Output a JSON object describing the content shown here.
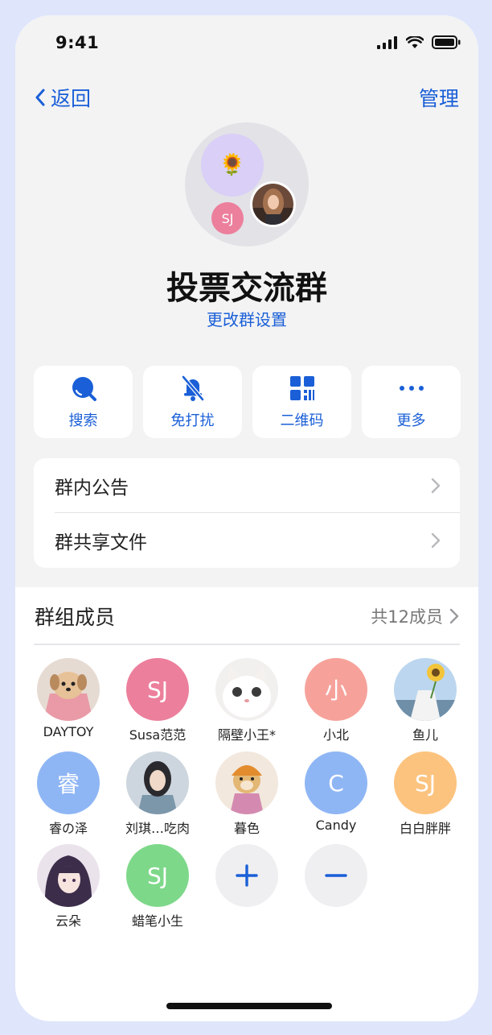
{
  "status": {
    "time": "9:41"
  },
  "nav": {
    "back_label": "返回",
    "manage_label": "管理"
  },
  "group": {
    "emoji": "🌻",
    "badge_initials": "SJ",
    "name": "投票交流群",
    "settings_link": "更改群设置"
  },
  "actions": [
    {
      "label": "搜索",
      "icon": "search-icon"
    },
    {
      "label": "免打扰",
      "icon": "bell-mute-icon"
    },
    {
      "label": "二维码",
      "icon": "qrcode-icon"
    },
    {
      "label": "更多",
      "icon": "more-icon"
    }
  ],
  "list": [
    {
      "label": "群内公告"
    },
    {
      "label": "群共享文件"
    }
  ],
  "members_section": {
    "title": "群组成员",
    "count": "共12成员"
  },
  "members": [
    {
      "name": "DAYTOY",
      "avatar": "photo-dog",
      "initials": ""
    },
    {
      "name": "Susa范范",
      "avatar": "initials",
      "initials": "SJ",
      "color": "#ec7f9c"
    },
    {
      "name": "隔壁小王*",
      "avatar": "photo-cat",
      "initials": ""
    },
    {
      "name": "小北",
      "avatar": "initials",
      "initials": "小",
      "color": "#f6a29b"
    },
    {
      "name": "鱼儿",
      "avatar": "photo-sunflower",
      "initials": ""
    },
    {
      "name": "睿の泽",
      "avatar": "initials",
      "initials": "睿",
      "color": "#8fb6f4"
    },
    {
      "name": "刘琪…吃肉",
      "avatar": "photo-girl",
      "initials": ""
    },
    {
      "name": "暮色",
      "avatar": "photo-doge",
      "initials": ""
    },
    {
      "name": "Candy",
      "avatar": "initials",
      "initials": "C",
      "color": "#8fb6f4"
    },
    {
      "name": "白白胖胖",
      "avatar": "initials",
      "initials": "SJ",
      "color": "#fcc37f"
    },
    {
      "name": "云朵",
      "avatar": "photo-anime",
      "initials": ""
    },
    {
      "name": "蜡笔小生",
      "avatar": "initials",
      "initials": "SJ",
      "color": "#7ed88a"
    }
  ],
  "add_button": {
    "icon": "plus-icon"
  },
  "remove_button": {
    "icon": "minus-icon"
  },
  "colors": {
    "accent": "#1a5fd7",
    "background": "#f3f3f4"
  }
}
